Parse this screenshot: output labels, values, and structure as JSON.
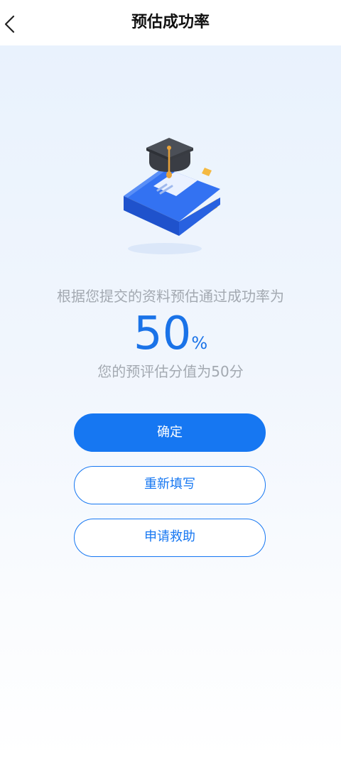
{
  "header": {
    "title": "预估成功率",
    "back_icon": "chevron-left-icon"
  },
  "illustration": {
    "icon": "book-graduation-cap-icon",
    "colors": {
      "book": "#2f6bf0",
      "pages": "#f5b544",
      "cap": "#3a3d44",
      "tassel": "#e8a23a"
    }
  },
  "result": {
    "description": "根据您提交的资料预估通过成功率为",
    "rate_value": "50",
    "rate_unit": "%",
    "score_text": "您的预评估分值为50分"
  },
  "actions": {
    "confirm_label": "确定",
    "refill_label": "重新填写",
    "help_label": "申请救助"
  },
  "colors": {
    "accent": "#1677f2",
    "muted_text": "#a3a9b1"
  }
}
